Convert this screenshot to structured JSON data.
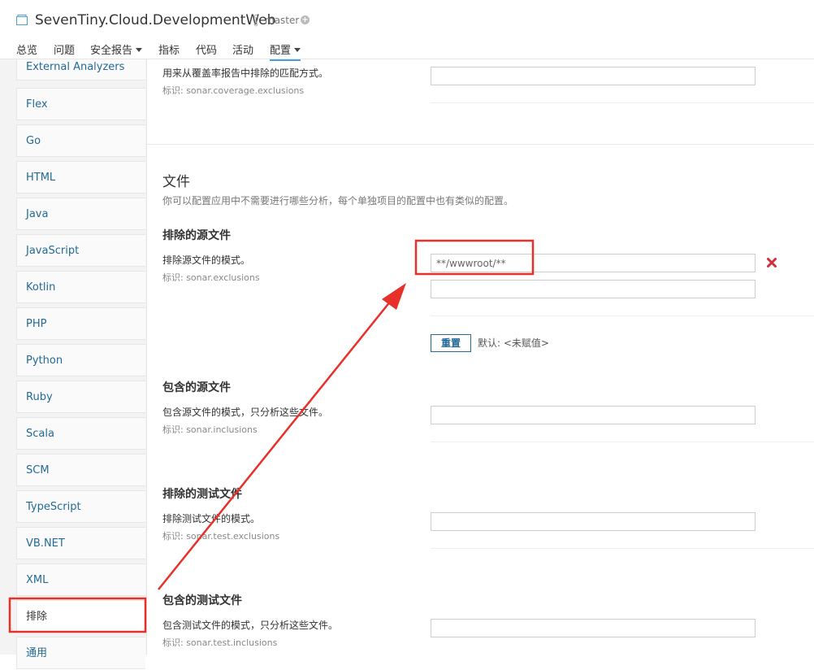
{
  "header": {
    "project_title": "SevenTiny.Cloud.DevelopmentWeb",
    "branch": "master",
    "branch_add": "+"
  },
  "nav": {
    "items": [
      {
        "label": "总览"
      },
      {
        "label": "问题"
      },
      {
        "label": "安全报告"
      },
      {
        "label": "指标"
      },
      {
        "label": "代码"
      },
      {
        "label": "活动"
      },
      {
        "label": "配置"
      }
    ],
    "active": "配置"
  },
  "sidebar": {
    "items": [
      {
        "label": "External Analyzers"
      },
      {
        "label": "Flex"
      },
      {
        "label": "Go"
      },
      {
        "label": "HTML"
      },
      {
        "label": "Java"
      },
      {
        "label": "JavaScript"
      },
      {
        "label": "Kotlin"
      },
      {
        "label": "PHP"
      },
      {
        "label": "Python"
      },
      {
        "label": "Ruby"
      },
      {
        "label": "Scala"
      },
      {
        "label": "SCM"
      },
      {
        "label": "TypeScript"
      },
      {
        "label": "VB.NET"
      },
      {
        "label": "XML"
      },
      {
        "label": "排除"
      },
      {
        "label": "通用"
      }
    ],
    "selected": "排除"
  },
  "main": {
    "coverage": {
      "description": "用来从覆盖率报告中排除的匹配方式。",
      "key": "标识: sonar.coverage.exclusions",
      "value": ""
    },
    "files_section": {
      "title": "文件",
      "description": "你可以配置应用中不需要进行哪些分析，每个单独项目的配置中也有类似的配置。"
    },
    "source_exclusions": {
      "title": "排除的源文件",
      "description": "排除源文件的模式。",
      "key": "标识: sonar.exclusions",
      "value": "**/wwwroot/**",
      "empty_value": "",
      "reset_label": "重置",
      "default_label": "默认: <未赋值>"
    },
    "source_inclusions": {
      "title": "包含的源文件",
      "description": "包含源文件的模式，只分析这些文件。",
      "key": "标识: sonar.inclusions",
      "value": ""
    },
    "test_exclusions": {
      "title": "排除的测试文件",
      "description": "排除测试文件的模式。",
      "key": "标识: sonar.test.exclusions",
      "value": ""
    },
    "test_inclusions": {
      "title": "包含的测试文件",
      "description": "包含测试文件的模式，只分析这些文件。",
      "key": "标识: sonar.test.inclusions",
      "value": ""
    }
  },
  "colors": {
    "link": "#236a97",
    "annotation": "#e8302a",
    "delete_icon": "#d02f3a",
    "nav_active": "#4b9fd5"
  },
  "icons": {
    "project": "project-icon",
    "branch": "branch-icon",
    "delete": "delete-icon"
  }
}
